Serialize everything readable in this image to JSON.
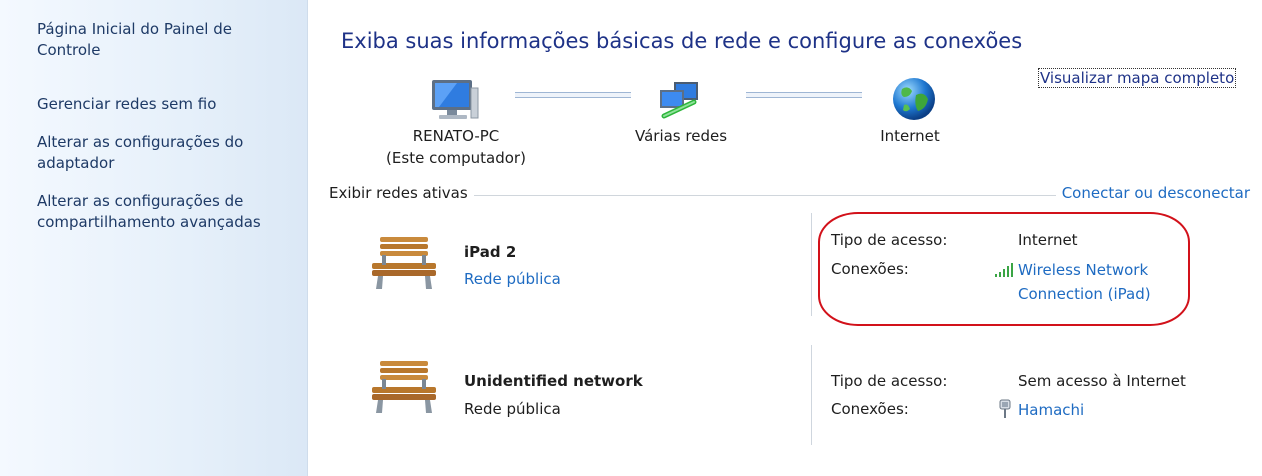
{
  "sidebar": {
    "items": [
      {
        "label": "Página Inicial do Painel de Controle"
      },
      {
        "label": "Gerenciar redes sem fio"
      },
      {
        "label": "Alterar as configurações do adaptador"
      },
      {
        "label": "Alterar as configurações de compartilhamento avançadas"
      }
    ]
  },
  "main": {
    "title": "Exiba suas informações básicas de rede e configure as conexões",
    "map_link": "Visualizar mapa completo",
    "nodes": [
      {
        "name": "RENATO-PC",
        "sub": "(Este computador)",
        "icon": "computer-icon"
      },
      {
        "name": "Várias redes",
        "icon": "multiple-networks-icon"
      },
      {
        "name": "Internet",
        "icon": "globe-icon"
      }
    ],
    "active_networks_label": "Exibir redes ativas",
    "connect_link": "Conectar ou desconectar",
    "networks": [
      {
        "name": "iPad  2",
        "type": "Rede pública",
        "type_is_link": true,
        "access_label": "Tipo de acesso:",
        "access_value": "Internet",
        "connections_label": "Conexões:",
        "connection_icon": "signal-bars-icon",
        "connection_line1": "Wireless Network",
        "connection_line2": "Connection (iPad)"
      },
      {
        "name": "Unidentified network",
        "type": "Rede pública",
        "type_is_link": false,
        "access_label": "Tipo de acesso:",
        "access_value": "Sem acesso à Internet",
        "connections_label": "Conexões:",
        "connection_icon": "network-adapter-icon",
        "connection_line1": "Hamachi"
      }
    ]
  },
  "colors": {
    "link": "#1e6bc2",
    "title": "#1e3287",
    "highlight": "#d2111a",
    "sidebar": "#e6f0fa"
  }
}
